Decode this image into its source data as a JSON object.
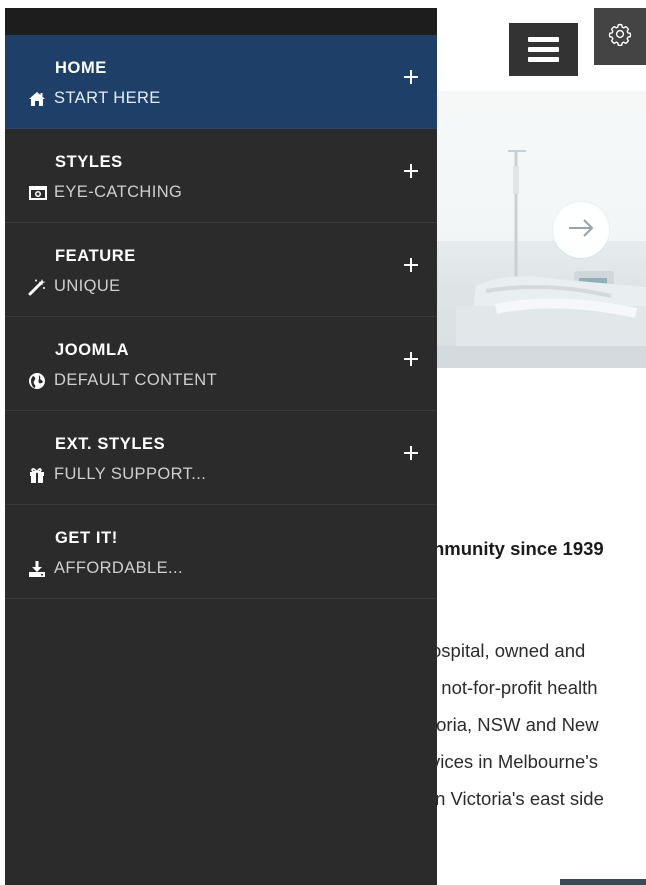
{
  "menu": {
    "items": [
      {
        "title": "HOME",
        "subtitle": "START HERE",
        "icon": "home-icon",
        "active": true,
        "has_children": true
      },
      {
        "title": "STYLES",
        "subtitle": "EYE-CATCHING",
        "icon": "camera-icon",
        "active": false,
        "has_children": true
      },
      {
        "title": "FEATURE",
        "subtitle": "UNIQUE",
        "icon": "magic-wand-icon",
        "active": false,
        "has_children": true
      },
      {
        "title": "JOOMLA",
        "subtitle": "DEFAULT CONTENT",
        "icon": "globe-icon",
        "active": false,
        "has_children": true
      },
      {
        "title": "EXT. STYLES",
        "subtitle": "FULLY SUPPORT...",
        "icon": "gift-icon",
        "active": false,
        "has_children": true
      },
      {
        "title": "GET IT!",
        "subtitle": "AFFORDABLE...",
        "icon": "download-icon",
        "active": false,
        "has_children": false
      }
    ],
    "expand_symbol": "+"
  },
  "header": {
    "menu_button_icon": "hamburger-icon",
    "settings_icon": "gear-icon"
  },
  "hero": {
    "next_icon": "arrow-right-icon"
  },
  "content": {
    "heading_fragment": "nmunity since 1939",
    "paragraph_lines": [
      "ospital, owned and",
      "t not-for-profit health",
      "toria, NSW and New",
      "vices in Melbourne's",
      "in Victoria's east side"
    ]
  },
  "colors": {
    "menu_background": "#2b2b2b",
    "menu_active": "#1e4068",
    "menu_divider": "#3a3a3a",
    "menu_text": "#ffffff",
    "dark_button": "#333333"
  }
}
